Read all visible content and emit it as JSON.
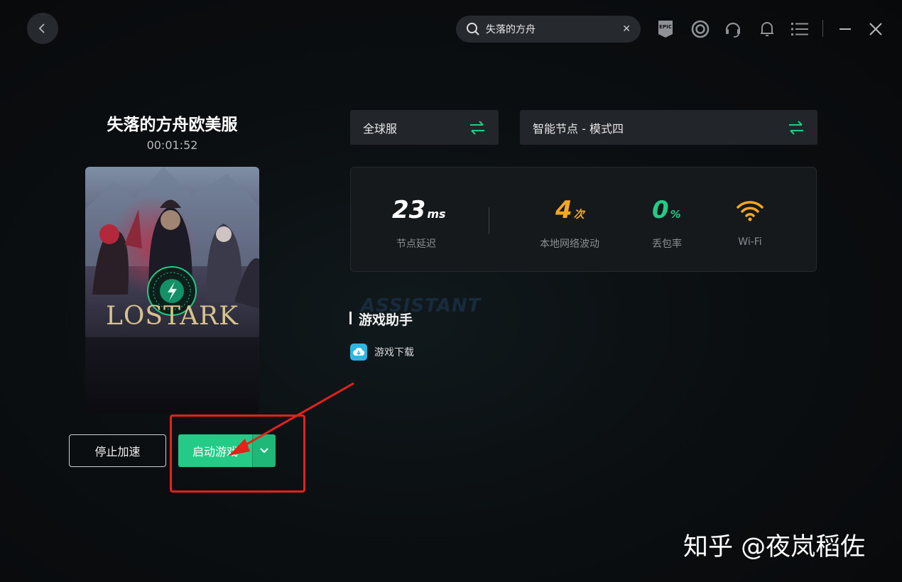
{
  "topbar": {
    "search_value": "失落的方舟",
    "icons": [
      "back-icon",
      "search-icon",
      "clear-icon",
      "epic-games-icon",
      "uplay-icon",
      "support-headset-icon",
      "bell-icon",
      "menu-icon",
      "minimize-icon",
      "close-icon"
    ]
  },
  "game": {
    "title": "失落的方舟欧美服",
    "elapsed": "00:01:52",
    "cover_text": "LOSTARK"
  },
  "actions": {
    "stop_label": "停止加速",
    "launch_label": "启动游戏"
  },
  "server": {
    "region": "全球服",
    "node": "智能节点 - 模式四"
  },
  "stats": {
    "latency": {
      "value": "23",
      "unit": "ms",
      "label": "节点延迟"
    },
    "fluctuation": {
      "value": "4",
      "unit": "次",
      "label": "本地网络波动"
    },
    "packet_loss": {
      "value": "0",
      "unit": "%",
      "label": "丢包率"
    },
    "network": {
      "label": "Wi-Fi"
    }
  },
  "assistant": {
    "bg_text": "ASSISTANT",
    "title": "游戏助手",
    "items": [
      {
        "label": "游戏下载"
      }
    ]
  },
  "credit": "知乎 @夜岚稻佐",
  "colors": {
    "accent_green": "#23cb86",
    "warn_orange": "#f5a623",
    "highlight_red": "#e8201a"
  }
}
